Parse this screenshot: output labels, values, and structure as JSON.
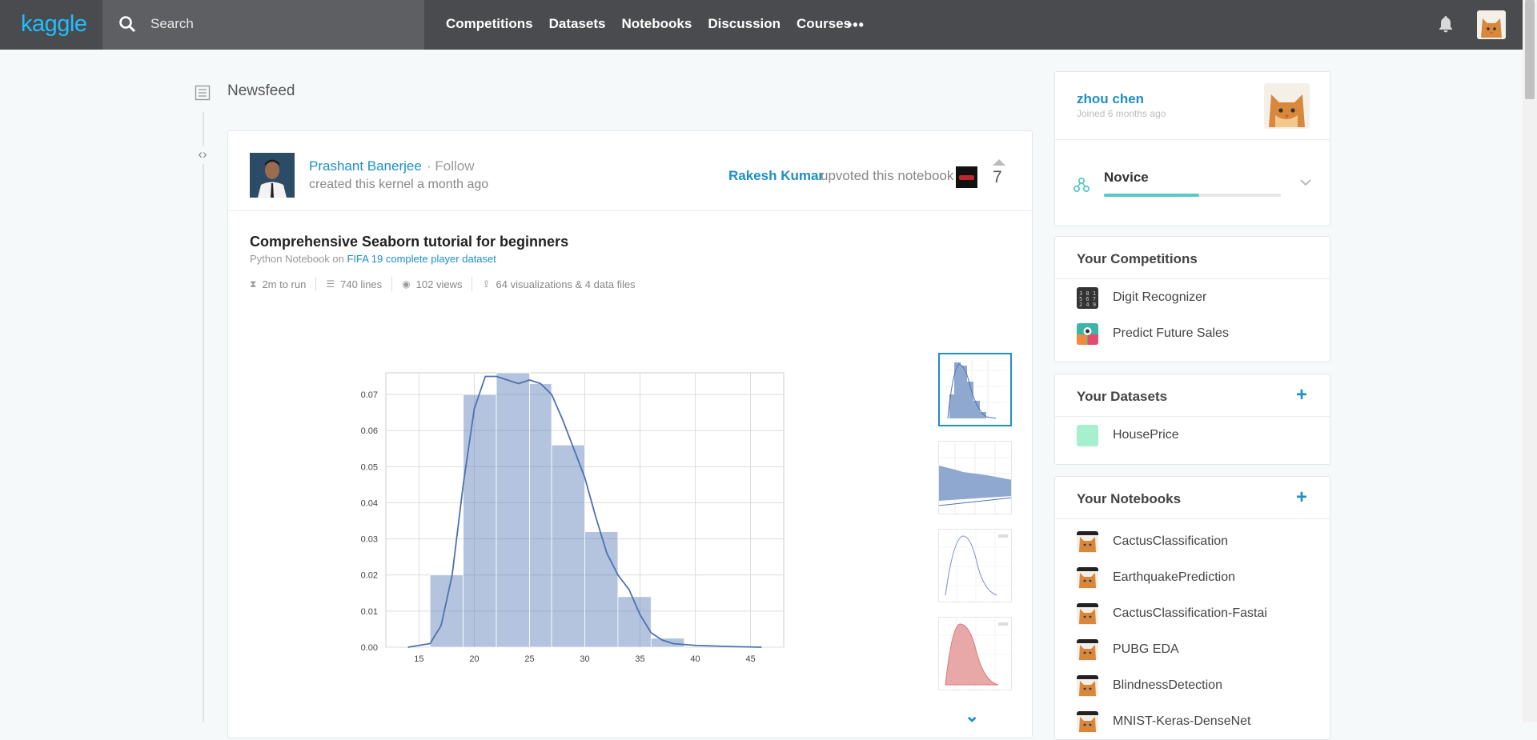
{
  "nav": {
    "logo": "kaggle",
    "search_placeholder": "Search",
    "links": [
      "Competitions",
      "Datasets",
      "Notebooks",
      "Discussion",
      "Courses"
    ],
    "more": "•••"
  },
  "feed": {
    "title": "Newsfeed",
    "card": {
      "author": "Prashant Banerjee",
      "follow": "Follow",
      "created": "created this kernel a month ago",
      "upvoter": "Rakesh Kumar",
      "upvote_text": "upvoted this notebook",
      "votes": "7",
      "notebook_title": "Comprehensive Seaborn tutorial for beginners",
      "notebook_type": "Python Notebook on",
      "dataset_link": "FIFA 19 complete player dataset",
      "stats": {
        "run": "2m to run",
        "lines": "740 lines",
        "views": "102 views",
        "outputs": "64 visualizations & 4 data files"
      }
    }
  },
  "chart_data": {
    "type": "bar",
    "bin_edges": [
      16,
      19,
      22,
      25,
      27,
      30,
      33,
      36,
      39
    ],
    "values": [
      0.02,
      0.07,
      0.076,
      0.073,
      0.056,
      0.032,
      0.014,
      0.0025
    ],
    "kde": {
      "x": [
        14,
        16,
        17,
        18,
        19,
        20,
        21,
        22,
        23,
        24,
        25,
        26,
        27,
        28,
        29,
        30,
        31,
        32,
        33,
        34,
        35,
        36,
        37,
        38,
        40,
        43,
        46
      ],
      "y": [
        0.0,
        0.001,
        0.006,
        0.02,
        0.045,
        0.066,
        0.075,
        0.075,
        0.074,
        0.073,
        0.074,
        0.073,
        0.07,
        0.063,
        0.055,
        0.047,
        0.036,
        0.026,
        0.02,
        0.016,
        0.009,
        0.004,
        0.002,
        0.001,
        0.0005,
        0.0002,
        0.0
      ]
    },
    "xticks": [
      15,
      20,
      25,
      30,
      35,
      40,
      45
    ],
    "yticks": [
      0.0,
      0.01,
      0.02,
      0.03,
      0.04,
      0.05,
      0.06,
      0.07
    ],
    "xlim": [
      12,
      48
    ],
    "ylim": [
      0,
      0.076
    ],
    "grid": true,
    "color": "#4c72b0"
  },
  "profile": {
    "name": "zhou chen",
    "joined": "Joined 6 months ago",
    "tier": "Novice",
    "tier_progress": 0.54
  },
  "competitions": {
    "title": "Your Competitions",
    "items": [
      "Digit Recognizer",
      "Predict Future Sales"
    ]
  },
  "datasets": {
    "title": "Your Datasets",
    "plus": "+",
    "items": [
      "HousePrice"
    ]
  },
  "notebooks": {
    "title": "Your Notebooks",
    "plus": "+",
    "items": [
      "CactusClassification",
      "EarthquakePrediction",
      "CactusClassification-Fastai",
      "PUBG EDA",
      "BlindnessDetection",
      "MNIST-Keras-DenseNet"
    ]
  }
}
